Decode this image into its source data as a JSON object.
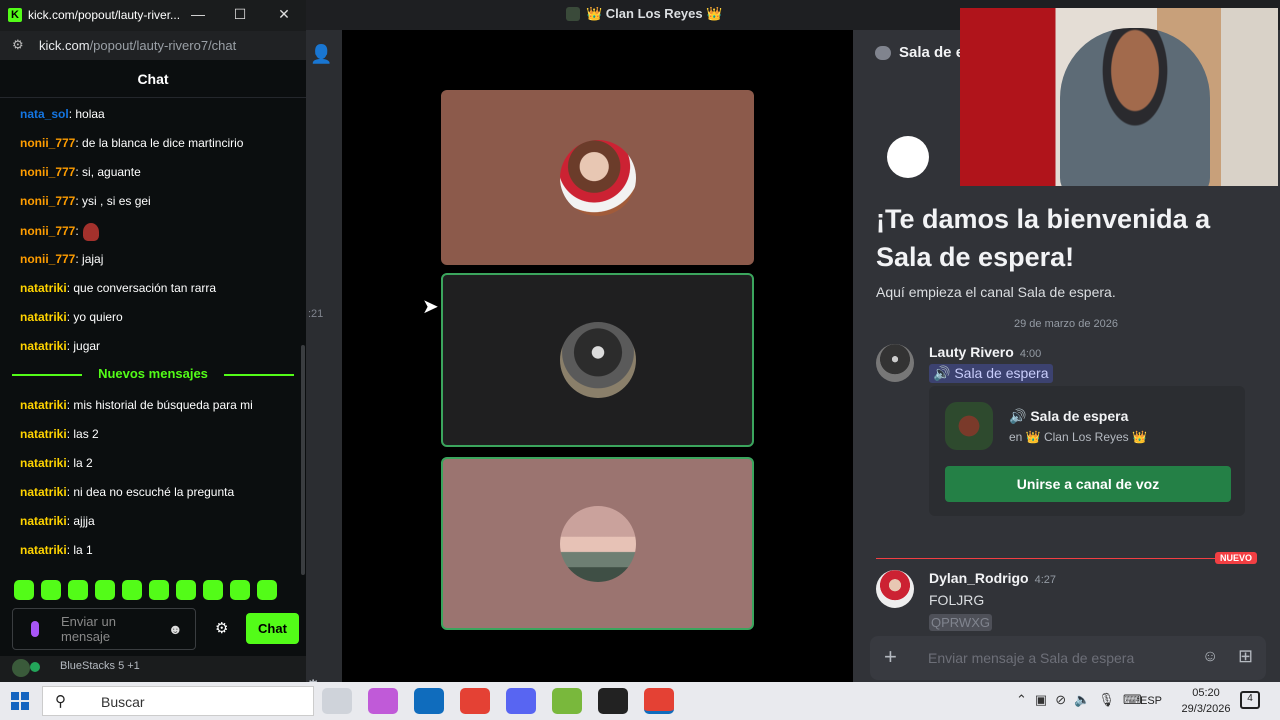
{
  "discord": {
    "window_title": "👑 Clan Los Reyes 👑",
    "left_strip_time": ":21",
    "channel_name": "Sala de e",
    "welcome_title": "¡Te damos la bienvenida a Sala de espera!",
    "welcome_sub": "Aquí empieza el canal Sala de espera.",
    "date_divider": "29 de marzo de 2026",
    "message1": {
      "author": "Lauty Rivero",
      "time": "4:00",
      "voice_link": "🔊 Sala de espera",
      "card_channel": "🔊 Sala de espera",
      "card_server": "en 👑 Clan Los Reyes 👑",
      "join_button": "Unirse a canal de voz"
    },
    "new_badge": "NUEVO",
    "message2": {
      "author": "Dylan_Rodrigo",
      "time": "4:27",
      "text": "FOLJRG",
      "spoiler": "QPRWXG"
    },
    "composer_placeholder": "Enviar mensaje a Sala de espera",
    "accent_color": "#248046"
  },
  "kick": {
    "window_title": "kick.com/popout/lauty-river...",
    "url_domain": "kick.com",
    "url_path": "/popout/lauty-rivero7/chat",
    "header": "Chat",
    "messages": [
      {
        "user": "nata_sol",
        "color": "blue",
        "text": ": holaa"
      },
      {
        "user": "nonii_777",
        "color": "orange",
        "text": ": de la blanca le dice martincirio"
      },
      {
        "user": "nonii_777",
        "color": "orange",
        "text": ": si, aguante"
      },
      {
        "user": "nonii_777",
        "color": "orange",
        "text": ": ysi , si es gei"
      },
      {
        "user": "nonii_777",
        "color": "orange",
        "text": ":",
        "emote": true
      },
      {
        "user": "nonii_777",
        "color": "orange",
        "text": ": jajaj"
      },
      {
        "user": "natatriki",
        "color": "yellow",
        "text": ": que conversación tan rarra"
      },
      {
        "user": "natatriki",
        "color": "yellow",
        "text": ": yo quiero"
      },
      {
        "user": "natatriki",
        "color": "yellow",
        "text": ": jugar"
      }
    ],
    "new_messages_label": "Nuevos mensajes",
    "new_messages": [
      {
        "user": "natatriki",
        "color": "yellow",
        "text": ": mis historial de búsqueda para mi"
      },
      {
        "user": "natatriki",
        "color": "yellow",
        "text": ": las 2"
      },
      {
        "user": "natatriki",
        "color": "yellow",
        "text": ": la 2"
      },
      {
        "user": "natatriki",
        "color": "yellow",
        "text": ": ni dea no escuché la pregunta"
      },
      {
        "user": "natatriki",
        "color": "yellow",
        "text": ": ajjja"
      },
      {
        "user": "natatriki",
        "color": "yellow",
        "text": ": la 1"
      }
    ],
    "input_placeholder": "Enviar un mensaje",
    "chat_button": "Chat",
    "accent_color": "#53fc18",
    "bluestacks_label": "BlueStacks 5 +1"
  },
  "taskbar": {
    "search_placeholder": "Buscar",
    "language": "ESP",
    "time": "05:20",
    "date": "29/3/2026",
    "notifications": "4"
  }
}
